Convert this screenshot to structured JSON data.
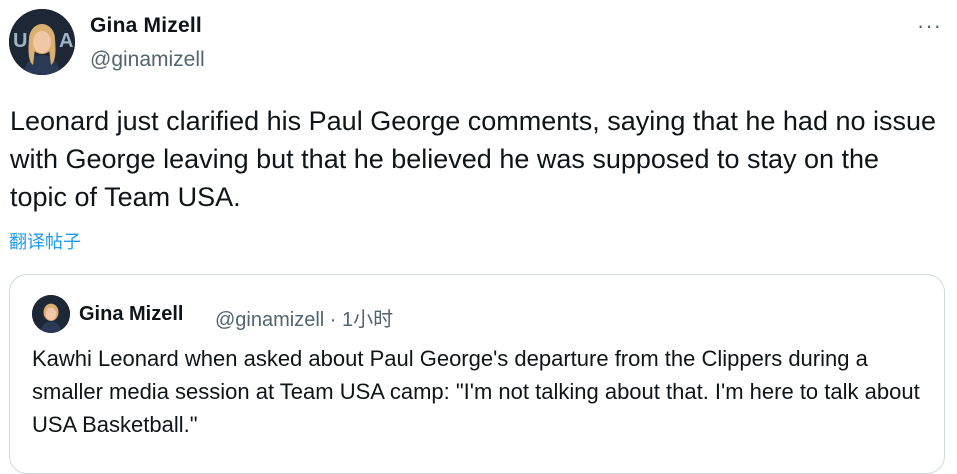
{
  "author": {
    "name": "Gina Mizell",
    "handle": "@ginamizell",
    "avatar_letters": "USA"
  },
  "more_icon": "more-horizontal-icon",
  "tweet": {
    "text": "Leonard just clarified his Paul George comments, saying that he had no issue with George leaving but that he believed he was supposed to stay on the topic of Team USA.",
    "translate_label": "翻译帖子"
  },
  "quote": {
    "name": "Gina Mizell",
    "handle_time": "@ginamizell · 1小时",
    "text": "Kawhi Leonard when asked about Paul George's departure from the Clippers during a smaller media session at Team USA camp: \"I'm not talking about that. I'm here to talk about USA Basketball.\""
  },
  "colors": {
    "link": "#1d9bf0",
    "secondary_text": "#536471",
    "border": "#cfd9de"
  }
}
